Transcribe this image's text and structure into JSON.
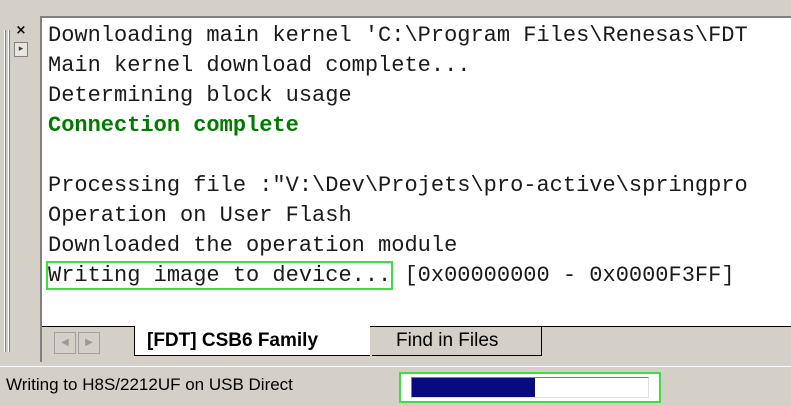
{
  "output_lines": [
    {
      "text": "Downloading main kernel 'C:\\Program Files\\Renesas\\FDT",
      "style": "normal"
    },
    {
      "text": "Main kernel download complete...",
      "style": "normal"
    },
    {
      "text": "Determining block usage",
      "style": "normal"
    },
    {
      "text": "Connection complete",
      "style": "green"
    },
    {
      "text": "",
      "style": "normal"
    },
    {
      "text": "Processing file :\"V:\\Dev\\Projets\\pro-active\\springpro",
      "style": "normal"
    },
    {
      "text": "Operation on User Flash",
      "style": "normal"
    },
    {
      "text": "Downloaded the operation module",
      "style": "normal"
    }
  ],
  "writing_line": {
    "highlighted": "Writing image to device...",
    "rest": " [0x00000000 - 0x0000F3FF]"
  },
  "tabs": [
    {
      "label": "[FDT] CSB6 Family",
      "active": true
    },
    {
      "label": "Find in Files",
      "active": false
    }
  ],
  "status": {
    "text": "Writing to H8S/2212UF on USB Direct",
    "progress": 0.52
  },
  "colors": {
    "highlight": "#3ce03c",
    "green_text": "#007a00",
    "progress_fill": "#0a0a80"
  },
  "icons": {
    "close": "close-icon",
    "dock": "dock-icon",
    "scroll_left": "scroll-left-icon",
    "scroll_right": "scroll-right-icon"
  }
}
